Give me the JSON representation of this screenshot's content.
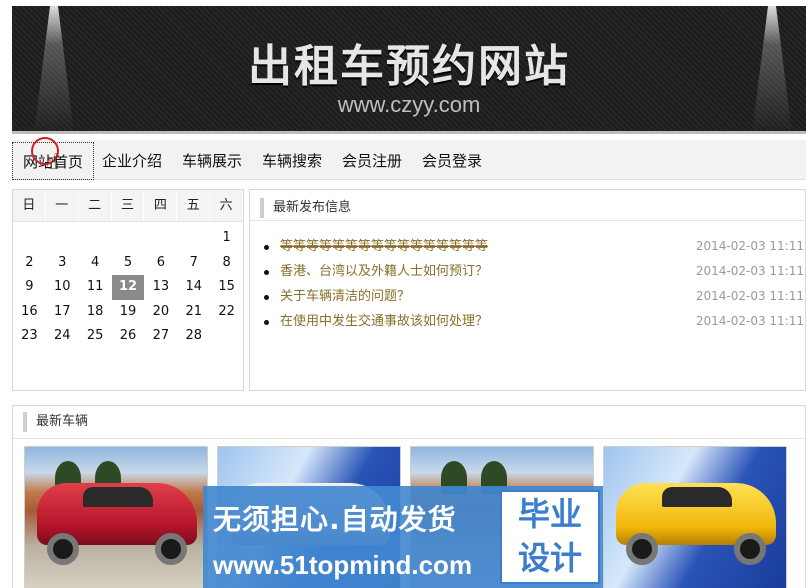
{
  "banner": {
    "title": "出租车预约网站",
    "subtitle": "www.czyy.com"
  },
  "nav": {
    "items": [
      {
        "label": "网站首页",
        "active": true
      },
      {
        "label": "企业介绍",
        "active": false
      },
      {
        "label": "车辆展示",
        "active": false
      },
      {
        "label": "车辆搜索",
        "active": false
      },
      {
        "label": "会员注册",
        "active": false
      },
      {
        "label": "会员登录",
        "active": false
      }
    ]
  },
  "calendar": {
    "weekdays": [
      "日",
      "一",
      "二",
      "三",
      "四",
      "五",
      "六"
    ],
    "weeks": [
      [
        "",
        "",
        "",
        "",
        "",
        "",
        "1"
      ],
      [
        "2",
        "3",
        "4",
        "5",
        "6",
        "7",
        "8"
      ],
      [
        "9",
        "10",
        "11",
        "12",
        "13",
        "14",
        "15"
      ],
      [
        "16",
        "17",
        "18",
        "19",
        "20",
        "21",
        "22"
      ],
      [
        "23",
        "24",
        "25",
        "26",
        "27",
        "28",
        ""
      ]
    ],
    "today": "12"
  },
  "news": {
    "title": "最新发布信息",
    "items": [
      {
        "text": "等等等等等等等等等等等等等等等等",
        "date": "2014-02-03 11:11"
      },
      {
        "text": "香港、台湾以及外籍人士如何预订？",
        "date": "2014-02-03 11:11"
      },
      {
        "text": "关于车辆清洁的问题？",
        "date": "2014-02-03 11:11"
      },
      {
        "text": "在使用中发生交通事故该如何处理？",
        "date": "2014-02-03 11:11"
      }
    ]
  },
  "vehicles": {
    "title": "最新车辆"
  },
  "watermark": {
    "line1": "无须担心.自动发货",
    "line2": "www.51topmind.com",
    "box_line1": "毕业",
    "box_line2": "设计"
  },
  "colors": {
    "link": "#8a6f2a",
    "watermark_bg": "#4288d0",
    "today_bg": "#8a8a8a"
  }
}
